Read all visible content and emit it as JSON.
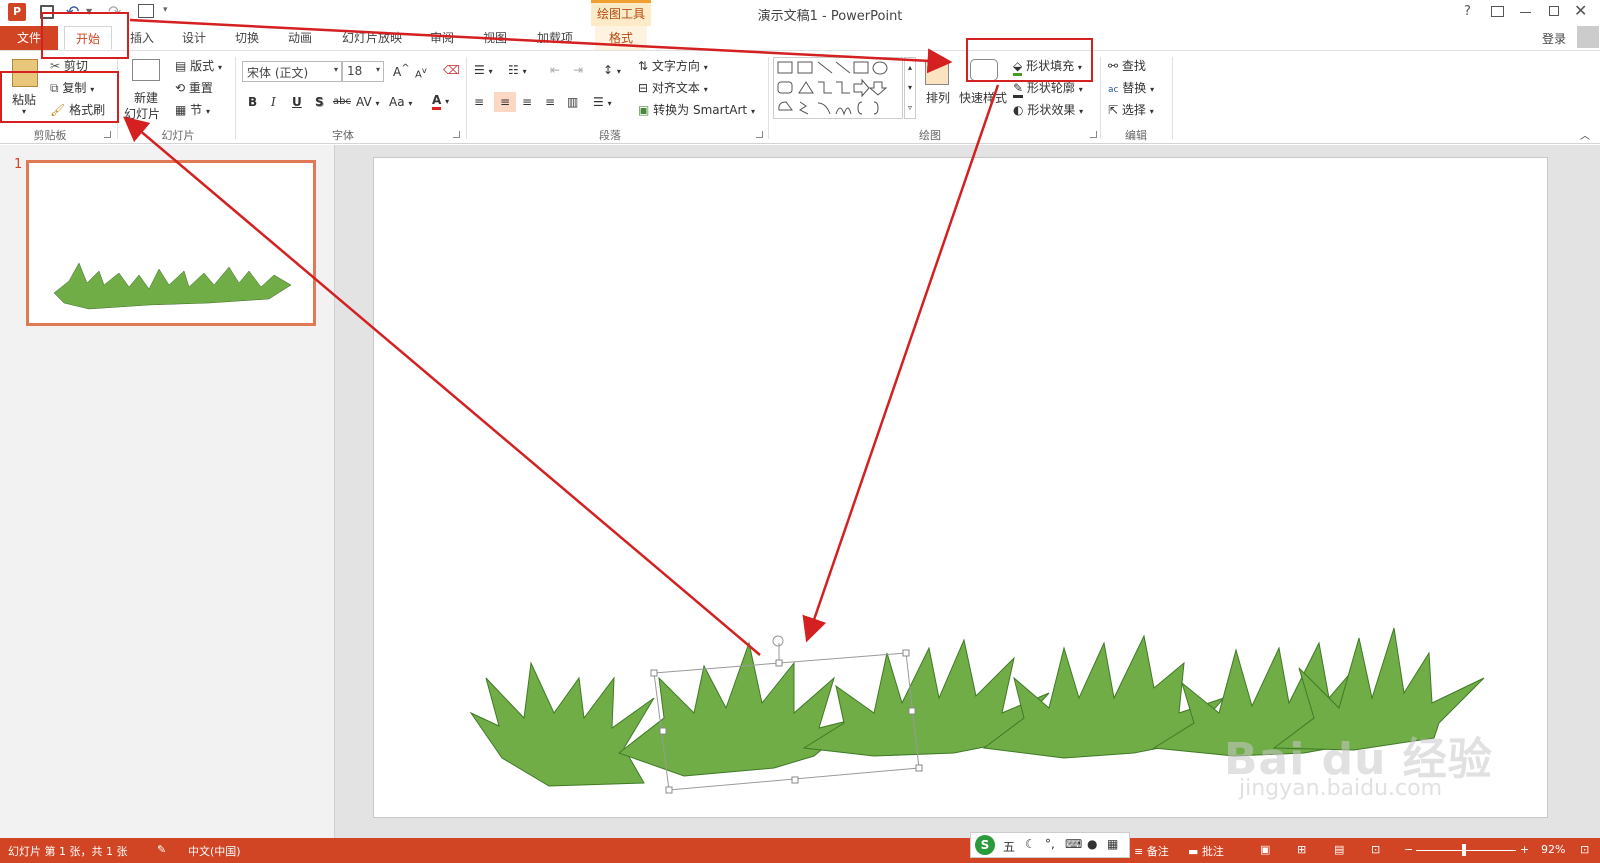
{
  "window": {
    "title": "演示文稿1 - PowerPoint",
    "context_tab_group": "绘图工具",
    "help": "?",
    "user": "登录"
  },
  "tabs": [
    {
      "label": "文件",
      "active": false
    },
    {
      "label": "开始",
      "active": true
    },
    {
      "label": "插入"
    },
    {
      "label": "设计"
    },
    {
      "label": "切换"
    },
    {
      "label": "动画"
    },
    {
      "label": "幻灯片放映"
    },
    {
      "label": "审阅"
    },
    {
      "label": "视图"
    },
    {
      "label": "加载项"
    },
    {
      "label": "格式"
    }
  ],
  "ribbon": {
    "clipboard": {
      "paste": "粘贴",
      "cut": "剪切",
      "copy": "复制",
      "format_painter": "格式刷",
      "label": "剪贴板"
    },
    "slides": {
      "new_slide_1": "新建",
      "new_slide_2": "幻灯片",
      "layout": "版式",
      "reset": "重置",
      "section": "节",
      "label": "幻灯片"
    },
    "font": {
      "name": "宋体 (正文)",
      "size": "18",
      "bold": "B",
      "italic": "I",
      "underline": "U",
      "shadow": "S",
      "strike": "abc",
      "spacing": "AV",
      "case": "Aa",
      "color": "A",
      "label": "字体"
    },
    "paragraph": {
      "text_direction": "文字方向",
      "align_text": "对齐文本",
      "smartart": "转换为 SmartArt",
      "label": "段落"
    },
    "drawing": {
      "arrange": "排列",
      "quick_styles": "快速样式",
      "shape_fill": "形状填充",
      "shape_outline": "形状轮廓",
      "shape_effects": "形状效果",
      "label": "绘图"
    },
    "editing": {
      "find": "查找",
      "replace": "替换",
      "select": "选择",
      "label": "编辑"
    }
  },
  "thumbnail": {
    "number": "1"
  },
  "watermark": {
    "brand": "Bai du 经验",
    "url": "jingyan.baidu.com"
  },
  "statusbar": {
    "slide_info": "幻灯片 第 1 张，共 1 张",
    "language": "中文(中国)",
    "ime": "五",
    "notes": "备注",
    "comments": "批注",
    "zoom": "92%"
  },
  "colors": {
    "accent": "#d14524",
    "grass": "#70ad47",
    "annotation": "#d42020"
  }
}
